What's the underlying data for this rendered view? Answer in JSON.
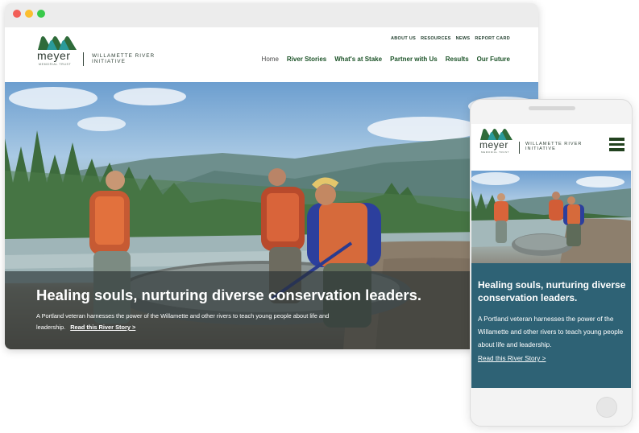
{
  "colors": {
    "nav_green": "#1c5328",
    "hero_overlay": "#262f30",
    "mobile_panel": "#2e6275",
    "logo_teal": "#2a9a9a",
    "logo_green": "#2f6b3a"
  },
  "window": {
    "controls": [
      "close-icon",
      "minimize-icon",
      "maximize-icon"
    ]
  },
  "logo": {
    "wordmark": "meyer",
    "subline": "MEMORIAL TRUST",
    "tagline_line1": "WILLAMETTE RIVER",
    "tagline_line2": "INITIATIVE"
  },
  "utility_nav": [
    "ABOUT US",
    "RESOURCES",
    "NEWS",
    "REPORT CARD"
  ],
  "main_nav": {
    "items": [
      "Home",
      "River Stories",
      "What's at Stake",
      "Partner with Us",
      "Results",
      "Our Future"
    ],
    "active": "Home"
  },
  "hero": {
    "headline": "Healing souls, nurturing diverse conservation leaders.",
    "text": "A Portland veteran harnesses the power of the Willamette and other rivers to teach young people about life and leadership.",
    "link": "Read this River Story >"
  },
  "mobile": {
    "menu_icon": "hamburger-menu-icon",
    "headline": "Healing souls, nurturing diverse conservation leaders.",
    "text": "A Portland veteran harnesses the power of the Willamette and other rivers to teach young people about life and leadership.",
    "link": "Read this River Story >"
  }
}
